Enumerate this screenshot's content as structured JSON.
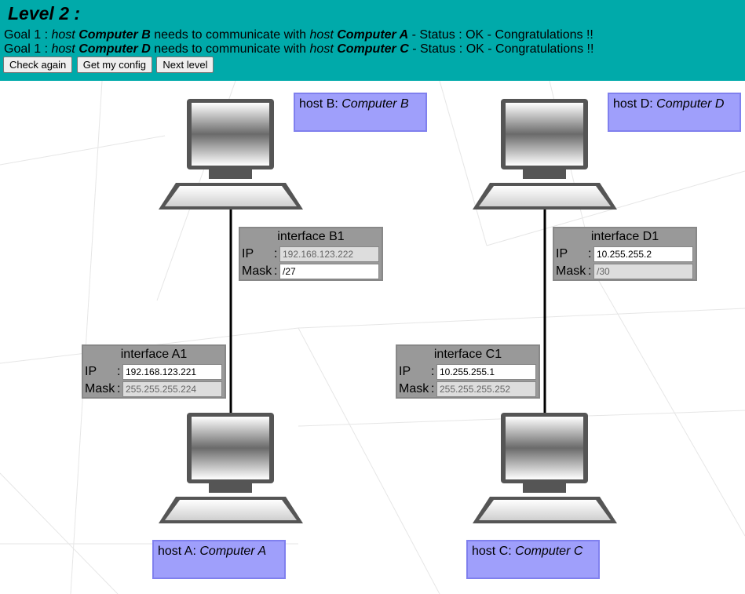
{
  "header": {
    "title": "Level 2 :",
    "goals": [
      {
        "prefix": "Goal 1 : ",
        "src_kind": "host",
        "src_name": "Computer B",
        "middle": " needs to communicate with ",
        "dst_kind": "host",
        "dst_name": "Computer A",
        "status": " - Status : OK - Congratulations !!"
      },
      {
        "prefix": "Goal 1 : ",
        "src_kind": "host",
        "src_name": "Computer D",
        "middle": " needs to communicate with ",
        "dst_kind": "host",
        "dst_name": "Computer C",
        "status": " - Status : OK - Congratulations !!"
      }
    ],
    "buttons": {
      "check": "Check again",
      "config": "Get my config",
      "next": "Next level"
    }
  },
  "hosts": {
    "a": {
      "prefix": "host A: ",
      "name": "Computer A"
    },
    "b": {
      "prefix": "host B: ",
      "name": "Computer B"
    },
    "c": {
      "prefix": "host C: ",
      "name": "Computer C"
    },
    "d": {
      "prefix": "host D: ",
      "name": "Computer D"
    }
  },
  "interfaces": {
    "b1": {
      "title": "interface B1",
      "ip_label": "IP",
      "mask_label": "Mask",
      "colon": ":",
      "ip": "192.168.123.222",
      "mask": "/27"
    },
    "d1": {
      "title": "interface D1",
      "ip_label": "IP",
      "mask_label": "Mask",
      "colon": ":",
      "ip": "10.255.255.2",
      "mask": "/30"
    },
    "a1": {
      "title": "interface A1",
      "ip_label": "IP",
      "mask_label": "Mask",
      "colon": ":",
      "ip": "192.168.123.221",
      "mask": "255.255.255.224"
    },
    "c1": {
      "title": "interface C1",
      "ip_label": "IP",
      "mask_label": "Mask",
      "colon": ":",
      "ip": "10.255.255.1",
      "mask": "255.255.255.252"
    }
  }
}
